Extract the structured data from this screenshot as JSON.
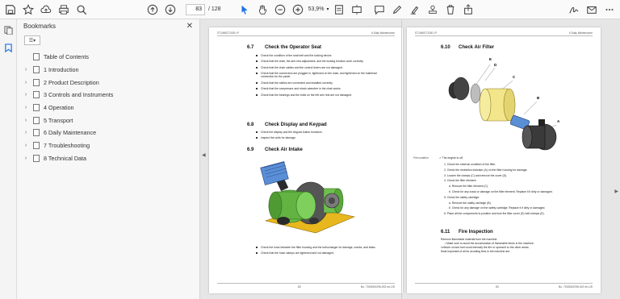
{
  "toolbar": {
    "current_page": "83",
    "total_pages": "/ 128",
    "zoom": "53,9%"
  },
  "panel": {
    "title": "Bookmarks",
    "close": "✕"
  },
  "bookmarks": [
    {
      "label": "Table of Contents",
      "expandable": false
    },
    {
      "label": "1 Introduction",
      "expandable": true
    },
    {
      "label": "2 Product Description",
      "expandable": true
    },
    {
      "label": "3 Controls and Instruments",
      "expandable": true
    },
    {
      "label": "4 Operation",
      "expandable": true
    },
    {
      "label": "5 Transport",
      "expandable": true
    },
    {
      "label": "6 Daily Maintenance",
      "expandable": true
    },
    {
      "label": "7 Troubleshooting",
      "expandable": true
    },
    {
      "label": "8 Technical Data",
      "expandable": true
    }
  ],
  "page_left": {
    "header_left": "ST1060ST1030 LP",
    "header_right": "6 Daily Maintenance",
    "s67_num": "6.7",
    "s67_title": "Check the Operator Seat",
    "s67_items": [
      "Check the condition of the seat belt and the locking device.",
      "Check that the chair, the arm rest adjustment, and the locking function work correctly.",
      "Check that the chair cables and the control levers are not damaged.",
      "Check that the connectors are plugged in, tightened on the chair, and tightened on the bulkhead connection for the panel.",
      "Check that the cables are connected and installed correctly.",
      "Check that the compressor and shock absorber in the chair works.",
      "Check that the bearings and the bolts on the left arm rest are not damaged."
    ],
    "s68_num": "6.8",
    "s68_title": "Check Display and Keypad",
    "s68_items": [
      "Check the display and the keypad button functions.",
      "Inspect the units for damage."
    ],
    "s69_num": "6.9",
    "s69_title": "Check Air Intake",
    "s69_items": [
      "Check the hose between the filter housing and the turbocharger for damage, cracks, and leaks.",
      "Check that the hose clamps are tightened and not damaged."
    ],
    "footer_page": "82",
    "footer_doc": "No. 7003000296.002 en-US"
  },
  "page_right": {
    "header_left": "ST1060ST1030 LP",
    "header_right": "6 Daily Maintenance",
    "s610_num": "6.10",
    "s610_title": "Check Air Filter",
    "figure_labels": [
      "E",
      "D",
      "C",
      "B",
      "A"
    ],
    "precondition_label": "Precondition",
    "precondition_text": "✓ The engine is off.",
    "steps": [
      "1.   Check the external condition of the filter.",
      "2.   Check the restriction indicator (A) on the filter housing for damage.",
      "3.   Loosen the clamps (C) and remove the cover (D).",
      "4.   Check the filter element:",
      "a.   Remove the filter element (C).",
      "b.   Check for any crack or damage on the filter element. Replace it if dirty or damaged.",
      "5.   Check the safety cartridge:",
      "a.   Remove the safety cartridge (B).",
      "b.   Check for any damage on the safety cartridge. Replace it if dirty or damaged.",
      "6.   Place all the components to position and lock the filter cover (D) with clamps (E)."
    ],
    "s611_num": "6.11",
    "s611_title": "Fire Inspection",
    "s611_lines": [
      "Remove flammable material from the machine.",
      "•  Make sure to avoid the accumulation of flammable items in the machine.",
      "Leftover oil and fuel could intensify the fire or spread it to the other areas.",
      "Most important of all for avoiding fires in the machine are:"
    ],
    "footer_page": "83",
    "footer_doc": "No. 7003000296.002 en-US"
  }
}
